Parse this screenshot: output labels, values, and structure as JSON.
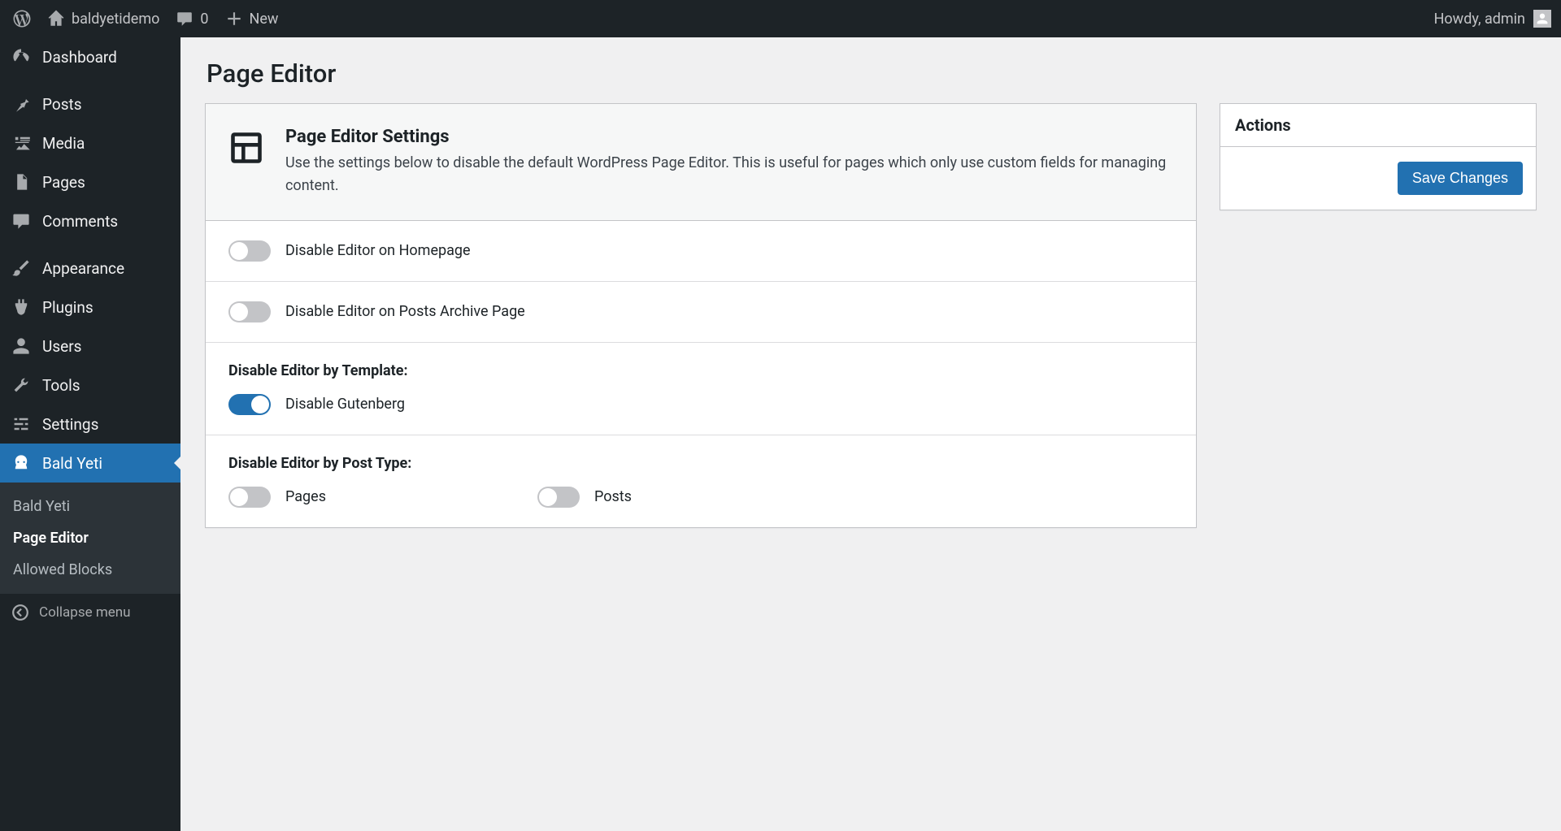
{
  "adminbar": {
    "site_name": "baldyetidemo",
    "comments_count": "0",
    "new_label": "New",
    "greeting": "Howdy, admin"
  },
  "sidebar": {
    "items": [
      {
        "label": "Dashboard",
        "icon": "dashboard"
      },
      {
        "label": "Posts",
        "icon": "pin"
      },
      {
        "label": "Media",
        "icon": "media"
      },
      {
        "label": "Pages",
        "icon": "page"
      },
      {
        "label": "Comments",
        "icon": "comment"
      },
      {
        "label": "Appearance",
        "icon": "brush"
      },
      {
        "label": "Plugins",
        "icon": "plug"
      },
      {
        "label": "Users",
        "icon": "user"
      },
      {
        "label": "Tools",
        "icon": "wrench"
      },
      {
        "label": "Settings",
        "icon": "sliders"
      },
      {
        "label": "Bald Yeti",
        "icon": "yeti"
      }
    ],
    "submenu": [
      {
        "label": "Bald Yeti",
        "active": false
      },
      {
        "label": "Page Editor",
        "active": true
      },
      {
        "label": "Allowed Blocks",
        "active": false
      }
    ],
    "collapse_label": "Collapse menu"
  },
  "page": {
    "title": "Page Editor",
    "settings_title": "Page Editor Settings",
    "settings_desc": "Use the settings below to disable the default WordPress Page Editor. This is useful for pages which only use custom fields for managing content.",
    "toggle_homepage": "Disable Editor on Homepage",
    "toggle_archive": "Disable Editor on Posts Archive Page",
    "section_template": "Disable Editor by Template:",
    "toggle_gutenberg": "Disable Gutenberg",
    "section_posttype": "Disable Editor by Post Type:",
    "toggle_pages": "Pages",
    "toggle_posts": "Posts"
  },
  "actions": {
    "heading": "Actions",
    "save_label": "Save Changes"
  }
}
